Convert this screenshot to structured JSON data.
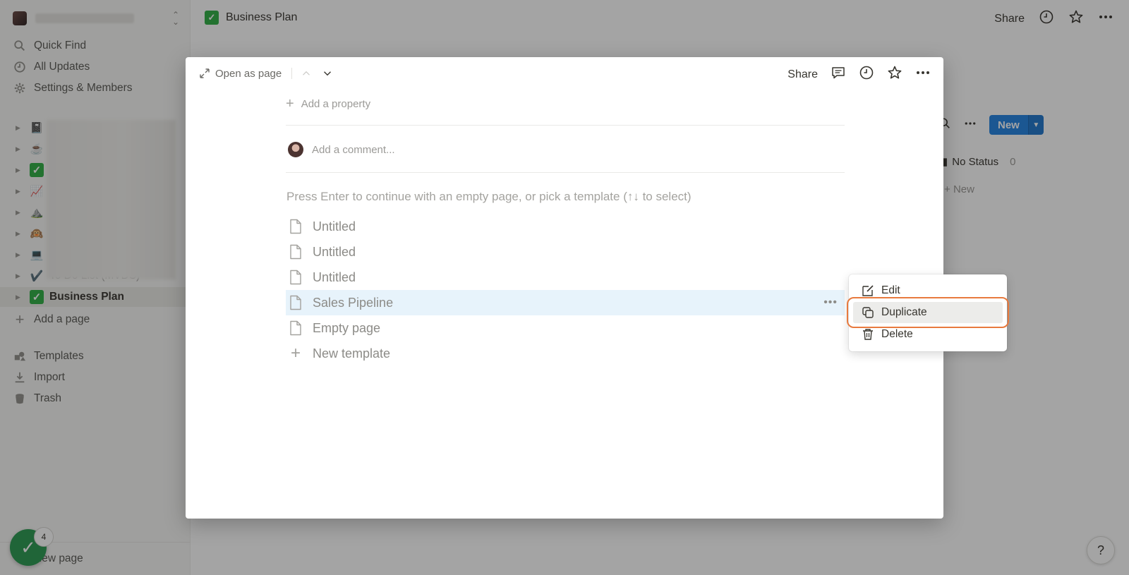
{
  "sidebar": {
    "nav": [
      {
        "label": "Quick Find",
        "icon": "search-icon"
      },
      {
        "label": "All Updates",
        "icon": "clock-icon"
      },
      {
        "label": "Settings & Members",
        "icon": "gear-icon"
      }
    ],
    "tree_emojis": [
      "📓",
      "☕",
      "✅",
      "📈",
      "⛰️",
      "🙉",
      "💻",
      "✔️"
    ],
    "tree_item_partial": "To Do List (MVDS)",
    "active_page": "Business Plan",
    "add_page": "Add a page",
    "bottom_nav": [
      {
        "label": "Templates",
        "icon": "templates-icon"
      },
      {
        "label": "Import",
        "icon": "import-icon"
      },
      {
        "label": "Trash",
        "icon": "trash-icon"
      }
    ],
    "new_page": "New page",
    "notification_count": "4"
  },
  "topbar": {
    "title": "Business Plan",
    "share": "Share"
  },
  "background": {
    "new_button": "New",
    "no_status": "No Status",
    "no_status_count": "0",
    "new_item": "New",
    "help": "?"
  },
  "modal": {
    "open_as_page": "Open as page",
    "share": "Share",
    "add_property": "Add a property",
    "add_comment": "Add a comment...",
    "hint": "Press Enter to continue with an empty page, or pick a template (↑↓ to select)",
    "templates": [
      "Untitled",
      "Untitled",
      "Untitled",
      "Sales Pipeline",
      "Empty page"
    ],
    "new_template": "New template"
  },
  "context_menu": {
    "items": [
      "Edit",
      "Duplicate",
      "Delete"
    ]
  },
  "colors": {
    "accent": "#2383e2",
    "focus_ring": "#e87a3e",
    "check_green": "#2fae44"
  }
}
